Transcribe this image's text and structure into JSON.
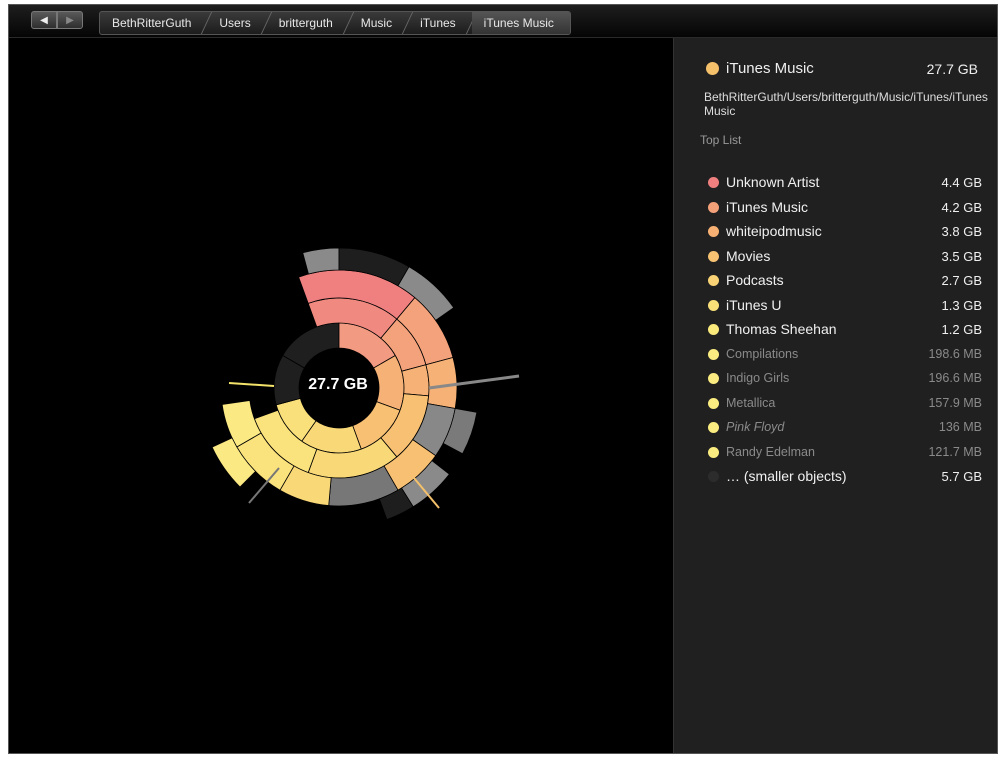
{
  "toolbar": {
    "back_icon": "◀",
    "forward_icon": "▶",
    "breadcrumb": [
      "BethRitterGuth",
      "Users",
      "britterguth",
      "Music",
      "iTunes",
      "iTunes Music"
    ]
  },
  "chart": {
    "center_label": "27.7 GB"
  },
  "sidebar": {
    "selected": {
      "name": "iTunes Music",
      "size": "27.7  GB",
      "color": "#f5c06a"
    },
    "path": "BethRitterGuth/Users/britterguth/Music/iTunes/iTunes Music",
    "top_list_title": "Top List",
    "items": [
      {
        "name": "Unknown Artist",
        "size": "4.4 GB",
        "color": "#f08080"
      },
      {
        "name": "iTunes Music",
        "size": "4.2 GB",
        "color": "#f4a079"
      },
      {
        "name": "whiteipodmusic",
        "size": "3.8 GB",
        "color": "#f6b073"
      },
      {
        "name": "Movies",
        "size": "3.5 GB",
        "color": "#f7c272"
      },
      {
        "name": "Podcasts",
        "size": "2.7 GB",
        "color": "#f8d274"
      },
      {
        "name": "iTunes U",
        "size": "1.3 GB",
        "color": "#f9df78"
      },
      {
        "name": "Thomas Sheehan",
        "size": "1.2 GB",
        "color": "#faea7c"
      },
      {
        "name": "Compilations",
        "size": "198.6 MB",
        "color": "#faec80"
      },
      {
        "name": "Indigo Girls",
        "size": "196.6 MB",
        "color": "#faec80"
      },
      {
        "name": "Metallica",
        "size": "157.9 MB",
        "color": "#faec80"
      },
      {
        "name": "Pink Floyd",
        "size": "136   MB",
        "color": "#faec80"
      },
      {
        "name": "Randy Edelman",
        "size": "121.7 MB",
        "color": "#faec80"
      },
      {
        "name": "… (smaller objects)",
        "size": "5.7 GB",
        "color": "#2c2c2c"
      }
    ]
  }
}
